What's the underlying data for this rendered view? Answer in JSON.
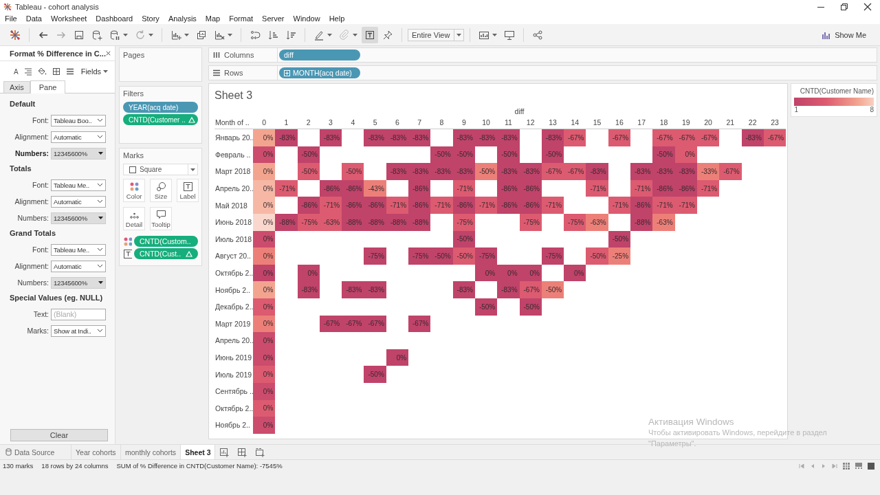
{
  "window": {
    "title": "Tableau - cohort analysis"
  },
  "menu": [
    "File",
    "Data",
    "Worksheet",
    "Dashboard",
    "Story",
    "Analysis",
    "Map",
    "Format",
    "Server",
    "Window",
    "Help"
  ],
  "toolbar": {
    "fit": "Entire View",
    "show_me": "Show Me"
  },
  "format_pane": {
    "title": "Format % Difference in C...",
    "font_tool": "A",
    "fields_menu": "Fields",
    "tabs": [
      {
        "label": "Axis",
        "selected": false
      },
      {
        "label": "Pane",
        "selected": true
      }
    ],
    "sections": [
      {
        "heading": "Default",
        "rows": [
          {
            "label": "Font:",
            "value": "Tableau Boo..",
            "kind": "select",
            "bold": false
          },
          {
            "label": "Alignment:",
            "value": "Automatic",
            "kind": "select",
            "bold": false
          },
          {
            "label": "Numbers:",
            "value": "12345600%",
            "kind": "format",
            "bold": true
          }
        ]
      },
      {
        "heading": "Totals",
        "rows": [
          {
            "label": "Font:",
            "value": "Tableau Me..",
            "kind": "select",
            "bold": false
          },
          {
            "label": "Alignment:",
            "value": "Automatic",
            "kind": "select",
            "bold": false
          },
          {
            "label": "Numbers:",
            "value": "12345600%",
            "kind": "format",
            "bold": false
          }
        ]
      },
      {
        "heading": "Grand Totals",
        "rows": [
          {
            "label": "Font:",
            "value": "Tableau Me..",
            "kind": "select",
            "bold": false
          },
          {
            "label": "Alignment:",
            "value": "Automatic",
            "kind": "select",
            "bold": false
          },
          {
            "label": "Numbers:",
            "value": "12345600%",
            "kind": "format",
            "bold": false
          }
        ]
      },
      {
        "heading": "Special Values (eg. NULL)",
        "rows": [
          {
            "label": "Text:",
            "placeholder": "(Blank)",
            "kind": "text",
            "bold": false
          },
          {
            "label": "Marks:",
            "value": "Show at Indi..",
            "kind": "select",
            "bold": false
          }
        ]
      }
    ],
    "clear_button": "Clear"
  },
  "pages": {
    "title": "Pages"
  },
  "filters": {
    "title": "Filters",
    "pills": [
      {
        "text": "YEAR(acq date)",
        "kind": "discrete",
        "delta": false
      },
      {
        "text": "CNTD(Customer ..",
        "kind": "continuous",
        "delta": true
      }
    ]
  },
  "marks": {
    "title": "Marks",
    "mark_type": "Square",
    "buttons": [
      {
        "label": "Color",
        "kind": "color"
      },
      {
        "label": "Size",
        "kind": "size"
      },
      {
        "label": "Label",
        "kind": "label"
      },
      {
        "label": "Detail",
        "kind": "detail"
      },
      {
        "label": "Tooltip",
        "kind": "tooltip"
      }
    ],
    "fields": [
      {
        "text": "CNTD(Custom..",
        "kind": "color",
        "delta": false
      },
      {
        "text": "CNTD(Cust..",
        "kind": "label",
        "delta": true
      }
    ]
  },
  "shelves": [
    {
      "label": "Columns",
      "kind": "columns",
      "pills": [
        {
          "text": "diff",
          "expandable": false
        }
      ]
    },
    {
      "label": "Rows",
      "kind": "rows",
      "pills": [
        {
          "text": "MONTH(acq date)",
          "expandable": true
        }
      ]
    }
  ],
  "sheet": {
    "title": "Sheet 3",
    "column_header": "diff",
    "row_header": "Month of ..",
    "columns": [
      "0",
      "1",
      "2",
      "3",
      "4",
      "5",
      "6",
      "7",
      "8",
      "9",
      "10",
      "11",
      "12",
      "13",
      "14",
      "15",
      "16",
      "17",
      "18",
      "19",
      "20",
      "21",
      "22",
      "23"
    ],
    "rows": [
      {
        "label": "Январь 20..",
        "cells": [
          {
            "kind": "mark",
            "text": "0%",
            "color": "#f3a48f"
          },
          {
            "kind": "mark",
            "text": "-83%",
            "color": "#c0436a"
          },
          {
            "kind": "empty"
          },
          {
            "kind": "mark",
            "text": "-83%",
            "color": "#c0436a"
          },
          {
            "kind": "empty"
          },
          {
            "kind": "mark",
            "text": "-83%",
            "color": "#c0436a"
          },
          {
            "kind": "mark",
            "text": "-83%",
            "color": "#c0436a"
          },
          {
            "kind": "mark",
            "text": "-83%",
            "color": "#c0436a"
          },
          {
            "kind": "empty"
          },
          {
            "kind": "mark",
            "text": "-83%",
            "color": "#c0436a"
          },
          {
            "kind": "mark",
            "text": "-83%",
            "color": "#c0436a"
          },
          {
            "kind": "mark",
            "text": "-83%",
            "color": "#c0436a"
          },
          {
            "kind": "empty"
          },
          {
            "kind": "mark",
            "text": "-83%",
            "color": "#c0436a"
          },
          {
            "kind": "mark",
            "text": "-67%",
            "color": "#dc5b70"
          },
          {
            "kind": "empty"
          },
          {
            "kind": "mark",
            "text": "-67%",
            "color": "#dc5b70"
          },
          {
            "kind": "empty"
          },
          {
            "kind": "mark",
            "text": "-67%",
            "color": "#dc5b70"
          },
          {
            "kind": "mark",
            "text": "-67%",
            "color": "#dc5b70"
          },
          {
            "kind": "mark",
            "text": "-67%",
            "color": "#dc5b70"
          },
          {
            "kind": "empty"
          },
          {
            "kind": "mark",
            "text": "-83%",
            "color": "#c0436a"
          },
          {
            "kind": "mark",
            "text": "-67%",
            "color": "#dc5b70"
          }
        ]
      },
      {
        "label": "Февраль ..",
        "cells": [
          {
            "kind": "mark",
            "text": "0%",
            "color": "#cc4c6d"
          },
          {
            "kind": "empty"
          },
          {
            "kind": "mark",
            "text": "-50%",
            "color": "#c0436a"
          },
          {
            "kind": "empty"
          },
          {
            "kind": "empty"
          },
          {
            "kind": "empty"
          },
          {
            "kind": "empty"
          },
          {
            "kind": "empty"
          },
          {
            "kind": "mark",
            "text": "-50%",
            "color": "#c0436a"
          },
          {
            "kind": "mark",
            "text": "-50%",
            "color": "#c0436a"
          },
          {
            "kind": "empty"
          },
          {
            "kind": "mark",
            "text": "-50%",
            "color": "#c0436a"
          },
          {
            "kind": "empty"
          },
          {
            "kind": "mark",
            "text": "-50%",
            "color": "#c0436a"
          },
          {
            "kind": "empty"
          },
          {
            "kind": "empty"
          },
          {
            "kind": "empty"
          },
          {
            "kind": "empty"
          },
          {
            "kind": "mark",
            "text": "-50%",
            "color": "#c0436a"
          },
          {
            "kind": "mark",
            "text": "0%",
            "color": "#dc5b70"
          },
          {
            "kind": "empty"
          },
          {
            "kind": "empty"
          },
          {
            "kind": "empty"
          },
          {
            "kind": "empty"
          }
        ]
      },
      {
        "label": "Март 2018",
        "cells": [
          {
            "kind": "mark",
            "text": "0%",
            "color": "#f3a48f"
          },
          {
            "kind": "empty"
          },
          {
            "kind": "mark",
            "text": "-50%",
            "color": "#dc5b70"
          },
          {
            "kind": "empty"
          },
          {
            "kind": "mark",
            "text": "-50%",
            "color": "#dc5b70"
          },
          {
            "kind": "empty"
          },
          {
            "kind": "mark",
            "text": "-83%",
            "color": "#c0436a"
          },
          {
            "kind": "mark",
            "text": "-83%",
            "color": "#c0436a"
          },
          {
            "kind": "mark",
            "text": "-83%",
            "color": "#c0436a"
          },
          {
            "kind": "mark",
            "text": "-83%",
            "color": "#c0436a"
          },
          {
            "kind": "mark",
            "text": "-50%",
            "color": "#ec8078"
          },
          {
            "kind": "mark",
            "text": "-83%",
            "color": "#c0436a"
          },
          {
            "kind": "mark",
            "text": "-83%",
            "color": "#c0436a"
          },
          {
            "kind": "mark",
            "text": "-67%",
            "color": "#dc5b70"
          },
          {
            "kind": "mark",
            "text": "-67%",
            "color": "#dc5b70"
          },
          {
            "kind": "mark",
            "text": "-83%",
            "color": "#c0436a"
          },
          {
            "kind": "empty"
          },
          {
            "kind": "mark",
            "text": "-83%",
            "color": "#c0436a"
          },
          {
            "kind": "mark",
            "text": "-83%",
            "color": "#c0436a"
          },
          {
            "kind": "mark",
            "text": "-83%",
            "color": "#c0436a"
          },
          {
            "kind": "mark",
            "text": "-33%",
            "color": "#ec8078"
          },
          {
            "kind": "mark",
            "text": "-67%",
            "color": "#dc5b70"
          },
          {
            "kind": "empty"
          },
          {
            "kind": "empty"
          }
        ]
      },
      {
        "label": "Апрель 20..",
        "cells": [
          {
            "kind": "mark",
            "text": "0%",
            "color": "#f6b8a5"
          },
          {
            "kind": "mark",
            "text": "-71%",
            "color": "#dc5b70"
          },
          {
            "kind": "empty"
          },
          {
            "kind": "mark",
            "text": "-86%",
            "color": "#c0436a"
          },
          {
            "kind": "mark",
            "text": "-86%",
            "color": "#c0436a"
          },
          {
            "kind": "mark",
            "text": "-43%",
            "color": "#ec8078"
          },
          {
            "kind": "empty"
          },
          {
            "kind": "mark",
            "text": "-86%",
            "color": "#c0436a"
          },
          {
            "kind": "empty"
          },
          {
            "kind": "mark",
            "text": "-71%",
            "color": "#dc5b70"
          },
          {
            "kind": "empty"
          },
          {
            "kind": "mark",
            "text": "-86%",
            "color": "#c0436a"
          },
          {
            "kind": "mark",
            "text": "-86%",
            "color": "#c0436a"
          },
          {
            "kind": "empty"
          },
          {
            "kind": "empty"
          },
          {
            "kind": "mark",
            "text": "-71%",
            "color": "#dc5b70"
          },
          {
            "kind": "empty"
          },
          {
            "kind": "mark",
            "text": "-71%",
            "color": "#dc5b70"
          },
          {
            "kind": "mark",
            "text": "-86%",
            "color": "#c0436a"
          },
          {
            "kind": "mark",
            "text": "-86%",
            "color": "#c0436a"
          },
          {
            "kind": "mark",
            "text": "-71%",
            "color": "#dc5b70"
          },
          {
            "kind": "empty"
          },
          {
            "kind": "empty"
          },
          {
            "kind": "empty"
          }
        ]
      },
      {
        "label": "Май 2018",
        "cells": [
          {
            "kind": "mark",
            "text": "0%",
            "color": "#f6b8a5"
          },
          {
            "kind": "empty"
          },
          {
            "kind": "mark",
            "text": "-86%",
            "color": "#c0436a"
          },
          {
            "kind": "mark",
            "text": "-71%",
            "color": "#dc5b70"
          },
          {
            "kind": "mark",
            "text": "-86%",
            "color": "#c0436a"
          },
          {
            "kind": "mark",
            "text": "-86%",
            "color": "#c0436a"
          },
          {
            "kind": "mark",
            "text": "-71%",
            "color": "#dc5b70"
          },
          {
            "kind": "mark",
            "text": "-86%",
            "color": "#c0436a"
          },
          {
            "kind": "mark",
            "text": "-71%",
            "color": "#dc5b70"
          },
          {
            "kind": "mark",
            "text": "-86%",
            "color": "#c0436a"
          },
          {
            "kind": "mark",
            "text": "-71%",
            "color": "#dc5b70"
          },
          {
            "kind": "mark",
            "text": "-86%",
            "color": "#c0436a"
          },
          {
            "kind": "mark",
            "text": "-86%",
            "color": "#c0436a"
          },
          {
            "kind": "mark",
            "text": "-71%",
            "color": "#dc5b70"
          },
          {
            "kind": "empty"
          },
          {
            "kind": "empty"
          },
          {
            "kind": "mark",
            "text": "-71%",
            "color": "#dc5b70"
          },
          {
            "kind": "mark",
            "text": "-86%",
            "color": "#c0436a"
          },
          {
            "kind": "mark",
            "text": "-71%",
            "color": "#dc5b70"
          },
          {
            "kind": "mark",
            "text": "-71%",
            "color": "#dc5b70"
          },
          {
            "kind": "empty"
          },
          {
            "kind": "empty"
          },
          {
            "kind": "empty"
          },
          {
            "kind": "empty"
          }
        ]
      },
      {
        "label": "Июнь 2018",
        "cells": [
          {
            "kind": "mark",
            "text": "0%",
            "color": "#fad7cc"
          },
          {
            "kind": "mark",
            "text": "-88%",
            "color": "#c0436a"
          },
          {
            "kind": "mark",
            "text": "-75%",
            "color": "#dc5b70"
          },
          {
            "kind": "mark",
            "text": "-63%",
            "color": "#dc5b70"
          },
          {
            "kind": "mark",
            "text": "-88%",
            "color": "#c0436a"
          },
          {
            "kind": "mark",
            "text": "-88%",
            "color": "#c0436a"
          },
          {
            "kind": "mark",
            "text": "-88%",
            "color": "#c0436a"
          },
          {
            "kind": "mark",
            "text": "-88%",
            "color": "#c0436a"
          },
          {
            "kind": "empty"
          },
          {
            "kind": "mark",
            "text": "-75%",
            "color": "#dc5b70"
          },
          {
            "kind": "empty"
          },
          {
            "kind": "empty"
          },
          {
            "kind": "mark",
            "text": "-75%",
            "color": "#dc5b70"
          },
          {
            "kind": "empty"
          },
          {
            "kind": "mark",
            "text": "-75%",
            "color": "#dc5b70"
          },
          {
            "kind": "mark",
            "text": "-63%",
            "color": "#ec8078"
          },
          {
            "kind": "empty"
          },
          {
            "kind": "mark",
            "text": "-88%",
            "color": "#c0436a"
          },
          {
            "kind": "mark",
            "text": "-63%",
            "color": "#ec8078"
          },
          {
            "kind": "empty"
          },
          {
            "kind": "empty"
          },
          {
            "kind": "empty"
          },
          {
            "kind": "empty"
          },
          {
            "kind": "empty"
          }
        ]
      },
      {
        "label": "Июль 2018",
        "cells": [
          {
            "kind": "mark",
            "text": "0%",
            "color": "#cc4c6d"
          },
          {
            "kind": "empty"
          },
          {
            "kind": "empty"
          },
          {
            "kind": "empty"
          },
          {
            "kind": "empty"
          },
          {
            "kind": "empty"
          },
          {
            "kind": "empty"
          },
          {
            "kind": "empty"
          },
          {
            "kind": "empty"
          },
          {
            "kind": "mark",
            "text": "-50%",
            "color": "#c0436a"
          },
          {
            "kind": "empty"
          },
          {
            "kind": "empty"
          },
          {
            "kind": "empty"
          },
          {
            "kind": "empty"
          },
          {
            "kind": "empty"
          },
          {
            "kind": "empty"
          },
          {
            "kind": "mark",
            "text": "-50%",
            "color": "#c0436a"
          },
          {
            "kind": "empty"
          },
          {
            "kind": "empty"
          },
          {
            "kind": "empty"
          },
          {
            "kind": "empty"
          },
          {
            "kind": "empty"
          },
          {
            "kind": "empty"
          },
          {
            "kind": "empty"
          }
        ]
      },
      {
        "label": "Август 20..",
        "cells": [
          {
            "kind": "mark",
            "text": "0%",
            "color": "#ec8078"
          },
          {
            "kind": "empty"
          },
          {
            "kind": "empty"
          },
          {
            "kind": "empty"
          },
          {
            "kind": "empty"
          },
          {
            "kind": "mark",
            "text": "-75%",
            "color": "#c0436a"
          },
          {
            "kind": "empty"
          },
          {
            "kind": "mark",
            "text": "-75%",
            "color": "#c0436a"
          },
          {
            "kind": "mark",
            "text": "-50%",
            "color": "#c0436a"
          },
          {
            "kind": "mark",
            "text": "-50%",
            "color": "#dc5b70"
          },
          {
            "kind": "mark",
            "text": "-75%",
            "color": "#c0436a"
          },
          {
            "kind": "empty"
          },
          {
            "kind": "empty"
          },
          {
            "kind": "mark",
            "text": "-75%",
            "color": "#c0436a"
          },
          {
            "kind": "empty"
          },
          {
            "kind": "mark",
            "text": "-50%",
            "color": "#dc5b70"
          },
          {
            "kind": "mark",
            "text": "-25%",
            "color": "#ec8078"
          },
          {
            "kind": "empty"
          },
          {
            "kind": "empty"
          },
          {
            "kind": "empty"
          },
          {
            "kind": "empty"
          },
          {
            "kind": "empty"
          },
          {
            "kind": "empty"
          },
          {
            "kind": "empty"
          }
        ]
      },
      {
        "label": "Октябрь 2..",
        "cells": [
          {
            "kind": "mark",
            "text": "0%",
            "color": "#c0436a"
          },
          {
            "kind": "empty"
          },
          {
            "kind": "mark",
            "text": "0%",
            "color": "#c0436a"
          },
          {
            "kind": "empty"
          },
          {
            "kind": "empty"
          },
          {
            "kind": "empty"
          },
          {
            "kind": "empty"
          },
          {
            "kind": "empty"
          },
          {
            "kind": "empty"
          },
          {
            "kind": "empty"
          },
          {
            "kind": "mark",
            "text": "0%",
            "color": "#c0436a"
          },
          {
            "kind": "mark",
            "text": "0%",
            "color": "#c0436a"
          },
          {
            "kind": "mark",
            "text": "0%",
            "color": "#c0436a"
          },
          {
            "kind": "empty"
          },
          {
            "kind": "mark",
            "text": "0%",
            "color": "#c0436a"
          },
          {
            "kind": "empty"
          },
          {
            "kind": "empty"
          },
          {
            "kind": "empty"
          },
          {
            "kind": "empty"
          },
          {
            "kind": "empty"
          },
          {
            "kind": "empty"
          },
          {
            "kind": "empty"
          },
          {
            "kind": "empty"
          },
          {
            "kind": "empty"
          }
        ]
      },
      {
        "label": "Ноябрь 2..",
        "cells": [
          {
            "kind": "mark",
            "text": "0%",
            "color": "#f3a48f"
          },
          {
            "kind": "empty"
          },
          {
            "kind": "mark",
            "text": "-83%",
            "color": "#c0436a"
          },
          {
            "kind": "empty"
          },
          {
            "kind": "mark",
            "text": "-83%",
            "color": "#c0436a"
          },
          {
            "kind": "mark",
            "text": "-83%",
            "color": "#c0436a"
          },
          {
            "kind": "empty"
          },
          {
            "kind": "empty"
          },
          {
            "kind": "empty"
          },
          {
            "kind": "mark",
            "text": "-83%",
            "color": "#c0436a"
          },
          {
            "kind": "empty"
          },
          {
            "kind": "mark",
            "text": "-83%",
            "color": "#c0436a"
          },
          {
            "kind": "mark",
            "text": "-67%",
            "color": "#dc5b70"
          },
          {
            "kind": "mark",
            "text": "-50%",
            "color": "#ec8078"
          },
          {
            "kind": "empty"
          },
          {
            "kind": "empty"
          },
          {
            "kind": "empty"
          },
          {
            "kind": "empty"
          },
          {
            "kind": "empty"
          },
          {
            "kind": "empty"
          },
          {
            "kind": "empty"
          },
          {
            "kind": "empty"
          },
          {
            "kind": "empty"
          },
          {
            "kind": "empty"
          }
        ]
      },
      {
        "label": "Декабрь 2..",
        "cells": [
          {
            "kind": "mark",
            "text": "0%",
            "color": "#dc5b70"
          },
          {
            "kind": "empty"
          },
          {
            "kind": "empty"
          },
          {
            "kind": "empty"
          },
          {
            "kind": "empty"
          },
          {
            "kind": "empty"
          },
          {
            "kind": "empty"
          },
          {
            "kind": "empty"
          },
          {
            "kind": "empty"
          },
          {
            "kind": "empty"
          },
          {
            "kind": "mark",
            "text": "-50%",
            "color": "#c0436a"
          },
          {
            "kind": "empty"
          },
          {
            "kind": "mark",
            "text": "-50%",
            "color": "#c0436a"
          },
          {
            "kind": "empty"
          },
          {
            "kind": "empty"
          },
          {
            "kind": "empty"
          },
          {
            "kind": "empty"
          },
          {
            "kind": "empty"
          },
          {
            "kind": "empty"
          },
          {
            "kind": "empty"
          },
          {
            "kind": "empty"
          },
          {
            "kind": "empty"
          },
          {
            "kind": "empty"
          },
          {
            "kind": "empty"
          }
        ]
      },
      {
        "label": "Март 2019",
        "cells": [
          {
            "kind": "mark",
            "text": "0%",
            "color": "#ec8078"
          },
          {
            "kind": "empty"
          },
          {
            "kind": "empty"
          },
          {
            "kind": "mark",
            "text": "-67%",
            "color": "#c0436a"
          },
          {
            "kind": "mark",
            "text": "-67%",
            "color": "#c0436a"
          },
          {
            "kind": "mark",
            "text": "-67%",
            "color": "#c0436a"
          },
          {
            "kind": "empty"
          },
          {
            "kind": "mark",
            "text": "-67%",
            "color": "#c0436a"
          },
          {
            "kind": "empty"
          },
          {
            "kind": "empty"
          },
          {
            "kind": "empty"
          },
          {
            "kind": "empty"
          },
          {
            "kind": "empty"
          },
          {
            "kind": "empty"
          },
          {
            "kind": "empty"
          },
          {
            "kind": "empty"
          },
          {
            "kind": "empty"
          },
          {
            "kind": "empty"
          },
          {
            "kind": "empty"
          },
          {
            "kind": "empty"
          },
          {
            "kind": "empty"
          },
          {
            "kind": "empty"
          },
          {
            "kind": "empty"
          },
          {
            "kind": "empty"
          }
        ]
      },
      {
        "label": "Апрель 20..",
        "cells": [
          {
            "kind": "mark",
            "text": "0%",
            "color": "#cc4c6d"
          },
          {
            "kind": "empty"
          },
          {
            "kind": "empty"
          },
          {
            "kind": "empty"
          },
          {
            "kind": "empty"
          },
          {
            "kind": "empty"
          },
          {
            "kind": "empty"
          },
          {
            "kind": "empty"
          },
          {
            "kind": "empty"
          },
          {
            "kind": "empty"
          },
          {
            "kind": "empty"
          },
          {
            "kind": "empty"
          },
          {
            "kind": "empty"
          },
          {
            "kind": "empty"
          },
          {
            "kind": "empty"
          },
          {
            "kind": "empty"
          },
          {
            "kind": "empty"
          },
          {
            "kind": "empty"
          },
          {
            "kind": "empty"
          },
          {
            "kind": "empty"
          },
          {
            "kind": "empty"
          },
          {
            "kind": "empty"
          },
          {
            "kind": "empty"
          },
          {
            "kind": "empty"
          }
        ]
      },
      {
        "label": "Июнь 2019",
        "cells": [
          {
            "kind": "mark",
            "text": "0%",
            "color": "#cc4c6d"
          },
          {
            "kind": "empty"
          },
          {
            "kind": "empty"
          },
          {
            "kind": "empty"
          },
          {
            "kind": "empty"
          },
          {
            "kind": "empty"
          },
          {
            "kind": "mark",
            "text": "0%",
            "color": "#c0436a"
          },
          {
            "kind": "empty"
          },
          {
            "kind": "empty"
          },
          {
            "kind": "empty"
          },
          {
            "kind": "empty"
          },
          {
            "kind": "empty"
          },
          {
            "kind": "empty"
          },
          {
            "kind": "empty"
          },
          {
            "kind": "empty"
          },
          {
            "kind": "empty"
          },
          {
            "kind": "empty"
          },
          {
            "kind": "empty"
          },
          {
            "kind": "empty"
          },
          {
            "kind": "empty"
          },
          {
            "kind": "empty"
          },
          {
            "kind": "empty"
          },
          {
            "kind": "empty"
          },
          {
            "kind": "empty"
          }
        ]
      },
      {
        "label": "Июль 2019",
        "cells": [
          {
            "kind": "mark",
            "text": "0%",
            "color": "#dc5b70"
          },
          {
            "kind": "empty"
          },
          {
            "kind": "empty"
          },
          {
            "kind": "empty"
          },
          {
            "kind": "empty"
          },
          {
            "kind": "mark",
            "text": "-50%",
            "color": "#c0436a"
          },
          {
            "kind": "empty"
          },
          {
            "kind": "empty"
          },
          {
            "kind": "empty"
          },
          {
            "kind": "empty"
          },
          {
            "kind": "empty"
          },
          {
            "kind": "empty"
          },
          {
            "kind": "empty"
          },
          {
            "kind": "empty"
          },
          {
            "kind": "empty"
          },
          {
            "kind": "empty"
          },
          {
            "kind": "empty"
          },
          {
            "kind": "empty"
          },
          {
            "kind": "empty"
          },
          {
            "kind": "empty"
          },
          {
            "kind": "empty"
          },
          {
            "kind": "empty"
          },
          {
            "kind": "empty"
          },
          {
            "kind": "empty"
          }
        ]
      },
      {
        "label": "Сентябрь ..",
        "cells": [
          {
            "kind": "mark",
            "text": "0%",
            "color": "#cc4c6d"
          },
          {
            "kind": "empty"
          },
          {
            "kind": "empty"
          },
          {
            "kind": "empty"
          },
          {
            "kind": "empty"
          },
          {
            "kind": "empty"
          },
          {
            "kind": "empty"
          },
          {
            "kind": "empty"
          },
          {
            "kind": "empty"
          },
          {
            "kind": "empty"
          },
          {
            "kind": "empty"
          },
          {
            "kind": "empty"
          },
          {
            "kind": "empty"
          },
          {
            "kind": "empty"
          },
          {
            "kind": "empty"
          },
          {
            "kind": "empty"
          },
          {
            "kind": "empty"
          },
          {
            "kind": "empty"
          },
          {
            "kind": "empty"
          },
          {
            "kind": "empty"
          },
          {
            "kind": "empty"
          },
          {
            "kind": "empty"
          },
          {
            "kind": "empty"
          },
          {
            "kind": "empty"
          }
        ]
      },
      {
        "label": "Октябрь 2..",
        "cells": [
          {
            "kind": "mark",
            "text": "0%",
            "color": "#dc5b70"
          },
          {
            "kind": "empty"
          },
          {
            "kind": "empty"
          },
          {
            "kind": "empty"
          },
          {
            "kind": "empty"
          },
          {
            "kind": "empty"
          },
          {
            "kind": "empty"
          },
          {
            "kind": "empty"
          },
          {
            "kind": "empty"
          },
          {
            "kind": "empty"
          },
          {
            "kind": "empty"
          },
          {
            "kind": "empty"
          },
          {
            "kind": "empty"
          },
          {
            "kind": "empty"
          },
          {
            "kind": "empty"
          },
          {
            "kind": "empty"
          },
          {
            "kind": "empty"
          },
          {
            "kind": "empty"
          },
          {
            "kind": "empty"
          },
          {
            "kind": "empty"
          },
          {
            "kind": "empty"
          },
          {
            "kind": "empty"
          },
          {
            "kind": "empty"
          },
          {
            "kind": "empty"
          }
        ]
      },
      {
        "label": "Ноябрь 2..",
        "cells": [
          {
            "kind": "mark",
            "text": "0%",
            "color": "#cc4c6d"
          },
          {
            "kind": "empty"
          },
          {
            "kind": "empty"
          },
          {
            "kind": "empty"
          },
          {
            "kind": "empty"
          },
          {
            "kind": "empty"
          },
          {
            "kind": "empty"
          },
          {
            "kind": "empty"
          },
          {
            "kind": "empty"
          },
          {
            "kind": "empty"
          },
          {
            "kind": "empty"
          },
          {
            "kind": "empty"
          },
          {
            "kind": "empty"
          },
          {
            "kind": "empty"
          },
          {
            "kind": "empty"
          },
          {
            "kind": "empty"
          },
          {
            "kind": "empty"
          },
          {
            "kind": "empty"
          },
          {
            "kind": "empty"
          },
          {
            "kind": "empty"
          },
          {
            "kind": "empty"
          },
          {
            "kind": "empty"
          },
          {
            "kind": "empty"
          },
          {
            "kind": "empty"
          }
        ]
      }
    ]
  },
  "legend": {
    "title": "CNTD(Customer Name)",
    "min": "1",
    "max": "8"
  },
  "sheet_tabs": [
    {
      "label": "Data Source",
      "kind": "datasource",
      "selected": false
    },
    {
      "label": "Year cohorts",
      "kind": "sheet",
      "selected": false
    },
    {
      "label": "monthly cohorts",
      "kind": "sheet",
      "selected": false
    },
    {
      "label": "Sheet 3",
      "kind": "sheet",
      "selected": true
    }
  ],
  "status_bar": [
    "130 marks",
    "18 rows by 24 columns",
    "SUM of % Difference in CNTD(Customer Name): -7545%"
  ],
  "windows_notice": {
    "title": "Активация Windows",
    "text": "Чтобы активировать Windows, перейдите в раздел \"Параметры\"."
  }
}
